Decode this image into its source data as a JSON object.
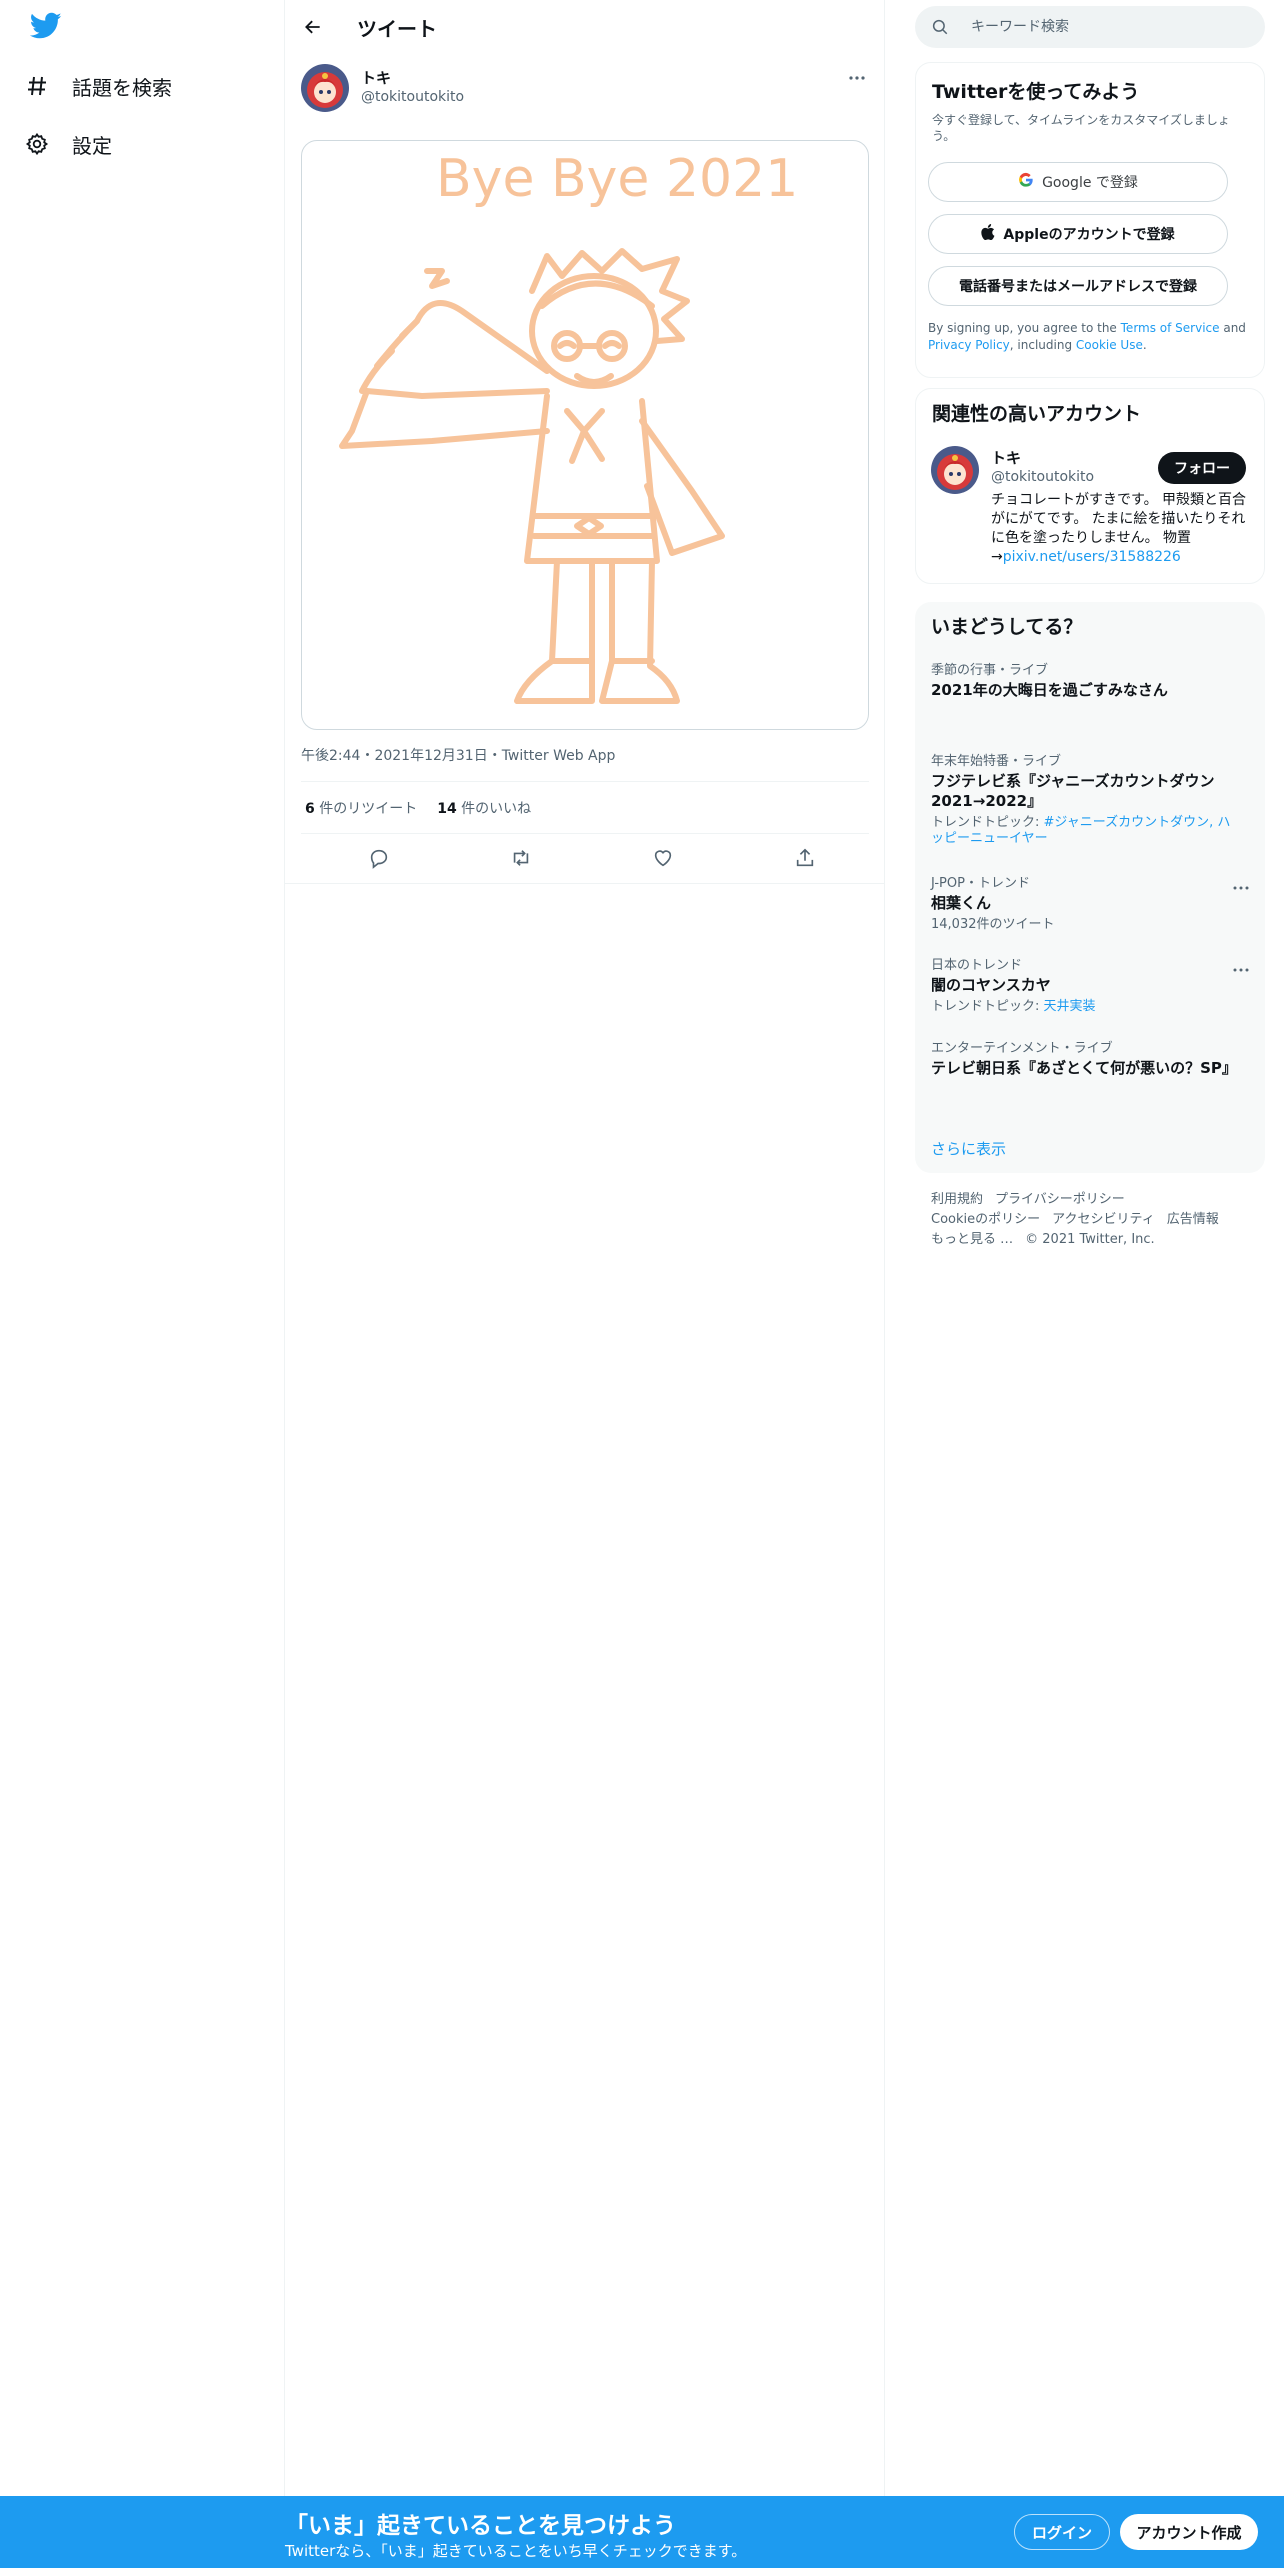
{
  "colors": {
    "accent": "#1d9bf0",
    "text": "#0f1419",
    "muted": "#536471",
    "drawing": "#f7c39a"
  },
  "nav": {
    "items": [
      {
        "label": "話題を検索",
        "icon": "hashtag-icon"
      },
      {
        "label": "設定",
        "icon": "gear-icon"
      }
    ]
  },
  "header": {
    "title": "ツイート"
  },
  "tweet": {
    "author_name": "トキ",
    "author_handle": "@tokitoutokito",
    "image_text": "Bye Bye 2021",
    "timestamp": "午後2:44・2021年12月31日・Twitter Web App",
    "retweets_count": "6",
    "retweets_label": "件のリツイート",
    "likes_count": "14",
    "likes_label": "件のいいね"
  },
  "search": {
    "placeholder": "キーワード検索"
  },
  "signup_card": {
    "title": "Twitterを使ってみよう",
    "subtitle": "今すぐ登録して、タイムラインをカスタマイズしましょう。",
    "google": "Google で登録",
    "apple": "Appleのアカウントで登録",
    "phone": "電話番号またはメールアドレスで登録",
    "terms_prefix": "By signing up, you agree to the ",
    "terms_link": "Terms of Service",
    "and": " and ",
    "privacy_link": "Privacy Policy",
    "including": ", including ",
    "cookie_link": "Cookie Use",
    "period": "."
  },
  "related": {
    "title": "関連性の高いアカウント",
    "name": "トキ",
    "handle": "@tokitoutokito",
    "follow": "フォロー",
    "bio": "チョコレートがすきです。 甲殻類と百合がにがてです。 たまに絵を描いたりそれに色を塗ったりしません。 物置→",
    "bio_link": "pixiv.net/users/31588226"
  },
  "trends": {
    "title": "いまどうしてる？",
    "items": [
      {
        "meta": "季節の行事・ライブ",
        "name": "2021年の大晦日を過ごすみなさん",
        "sub": "",
        "sub_link": ""
      },
      {
        "meta": "年末年始特番・ライブ",
        "name": "フジテレビ系『ジャニーズカウントダウン2021→2022』",
        "sub": "トレンドトピック: ",
        "sub_link": "#ジャニーズカウントダウン, ハッピーニューイヤー"
      },
      {
        "meta": "J-POP・トレンド",
        "name": "相葉くん",
        "sub": "14,032件のツイート",
        "sub_link": ""
      },
      {
        "meta": "日本のトレンド",
        "name": "闇のコヤンスカヤ",
        "sub": "トレンドトピック: ",
        "sub_link": "天井実装"
      },
      {
        "meta": "エンターテインメント・ライブ",
        "name": "テレビ朝日系『あざとくて何が悪いの？SP』",
        "sub": "",
        "sub_link": ""
      }
    ],
    "show_more": "さらに表示"
  },
  "footer": {
    "links": [
      "利用規約",
      "プライバシーポリシー",
      "Cookieのポリシー",
      "アクセシビリティ",
      "広告情報",
      "もっと見る …"
    ],
    "copyright": "© 2021 Twitter, Inc."
  },
  "bottom": {
    "title": "「いま」起きていることを見つけよう",
    "subtitle": "Twitterなら、「いま」起きていることをいち早くチェックできます。",
    "login": "ログイン",
    "signup": "アカウント作成"
  }
}
